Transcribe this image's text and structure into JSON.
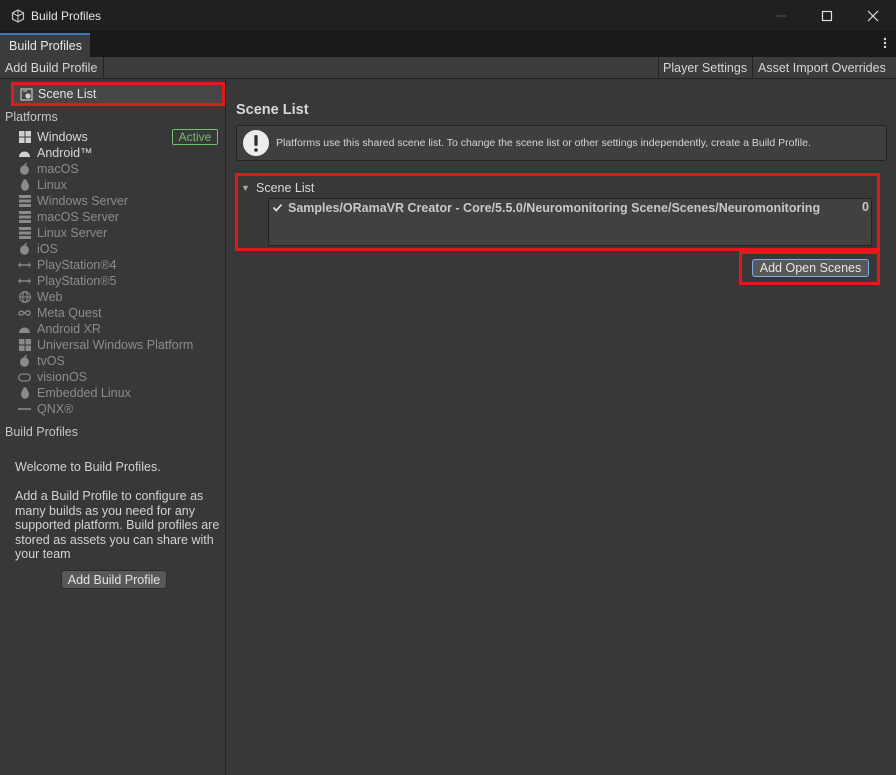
{
  "window": {
    "title": "Build Profiles",
    "icon": "unity-icon",
    "controls": [
      "minimize-icon",
      "maximize-icon",
      "close-icon"
    ]
  },
  "tabs": [
    {
      "label": "Build Profiles",
      "active": true
    }
  ],
  "toolbar": {
    "add_build_profile": "Add Build Profile",
    "player_settings": "Player Settings",
    "asset_import_overrides": "Asset Import Overrides"
  },
  "sidebar": {
    "scene_list_label": "Scene List",
    "platforms_heading": "Platforms",
    "platforms": [
      {
        "label": "Windows",
        "icon": "windows-icon",
        "enabled": true
      },
      {
        "label": "Android™",
        "icon": "android-icon",
        "enabled": true
      },
      {
        "label": "macOS",
        "icon": "apple-icon",
        "enabled": false
      },
      {
        "label": "Linux",
        "icon": "linux-icon",
        "enabled": false
      },
      {
        "label": "Windows Server",
        "icon": "server-icon",
        "enabled": false
      },
      {
        "label": "macOS Server",
        "icon": "server-icon",
        "enabled": false
      },
      {
        "label": "Linux Server",
        "icon": "server-icon",
        "enabled": false
      },
      {
        "label": "iOS",
        "icon": "apple-icon",
        "enabled": false
      },
      {
        "label": "PlayStation®4",
        "icon": "ps4-icon",
        "enabled": false
      },
      {
        "label": "PlayStation®5",
        "icon": "ps5-icon",
        "enabled": false
      },
      {
        "label": "Web",
        "icon": "globe-icon",
        "enabled": false
      },
      {
        "label": "Meta Quest",
        "icon": "meta-icon",
        "enabled": false
      },
      {
        "label": "Android XR",
        "icon": "android-icon",
        "enabled": false
      },
      {
        "label": "Universal Windows Platform",
        "icon": "windows-icon",
        "enabled": false
      },
      {
        "label": "tvOS",
        "icon": "apple-icon",
        "enabled": false
      },
      {
        "label": "visionOS",
        "icon": "vision-icon",
        "enabled": false
      },
      {
        "label": "Embedded Linux",
        "icon": "embedded-linux-icon",
        "enabled": false
      },
      {
        "label": "QNX®",
        "icon": "qnx-icon",
        "enabled": false
      }
    ],
    "active_badge": "Active",
    "build_profiles_heading": "Build Profiles",
    "welcome_title": "Welcome to Build Profiles.",
    "welcome_body": "Add a Build Profile to configure as many builds as you need for any supported platform. Build profiles are stored as assets you can share with your team",
    "add_build_profile_button": "Add Build Profile"
  },
  "main": {
    "title": "Scene List",
    "help_message": "Platforms use this shared scene list. To change the scene list or other settings independently, create a Build Profile.",
    "scene_list_foldout": "Scene List",
    "scenes": [
      {
        "path": "Samples/ORamaVR Creator - Core/5.5.0/Neuromonitoring Scene/Scenes/Neuromonitoring",
        "index": "0",
        "checked": true
      }
    ],
    "add_open_scenes_button": "Add Open Scenes"
  },
  "colors": {
    "highlight": "#e01a1a",
    "active_badge": "#6fc26f",
    "tab_accent": "#3a79bb"
  }
}
